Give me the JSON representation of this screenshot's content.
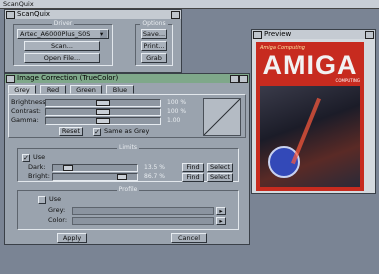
{
  "screen": {
    "title": "ScanQuix"
  },
  "main": {
    "title": "ScanQuix",
    "driver_label": "Driver",
    "driver_value": "Artec_A6000Plus_S0S",
    "scan_label": "Scan...",
    "open_label": "Open File...",
    "options_label": "Options",
    "options_items": [
      "Save...",
      "Print...",
      "Grab"
    ]
  },
  "preview": {
    "title": "Preview",
    "cover_logo": "AMIGA",
    "cover_top": "Amiga Computing",
    "cover_sub": "COMPUTING"
  },
  "image": {
    "title": "Image Correction (TrueColor)",
    "tabs": [
      "Grey",
      "Red",
      "Green",
      "Blue"
    ],
    "sliders": [
      {
        "label": "Brightness:",
        "value": "100 %",
        "level": 0.5
      },
      {
        "label": "Contrast:",
        "value": "100 %",
        "level": 0.5
      },
      {
        "label": "Gamma:",
        "value": "1.00",
        "level": 0.5
      }
    ],
    "reset_label": "Reset",
    "same_as_grey_label": "Same as Grey",
    "same_as_grey_checked": true
  },
  "limits": {
    "title": "Limits",
    "use_label": "Use",
    "use_checked": true,
    "dark_label": "Dark:",
    "dark_value": "13.5 %",
    "dark_level": 0.135,
    "bright_label": "Bright:",
    "bright_value": "86.7 %",
    "bright_level": 0.867,
    "buttons": [
      "Find",
      "Select",
      "Find",
      "Select"
    ]
  },
  "profile": {
    "title": "Profile",
    "use_label": "Use",
    "use_checked": false,
    "grey_label": "Grey:",
    "color_label": "Color:"
  },
  "footer": {
    "apply_label": "Apply",
    "cancel_label": "Cancel"
  },
  "colors": {
    "active_title": "#7fa88a",
    "cover_red": "#c72b1f"
  }
}
